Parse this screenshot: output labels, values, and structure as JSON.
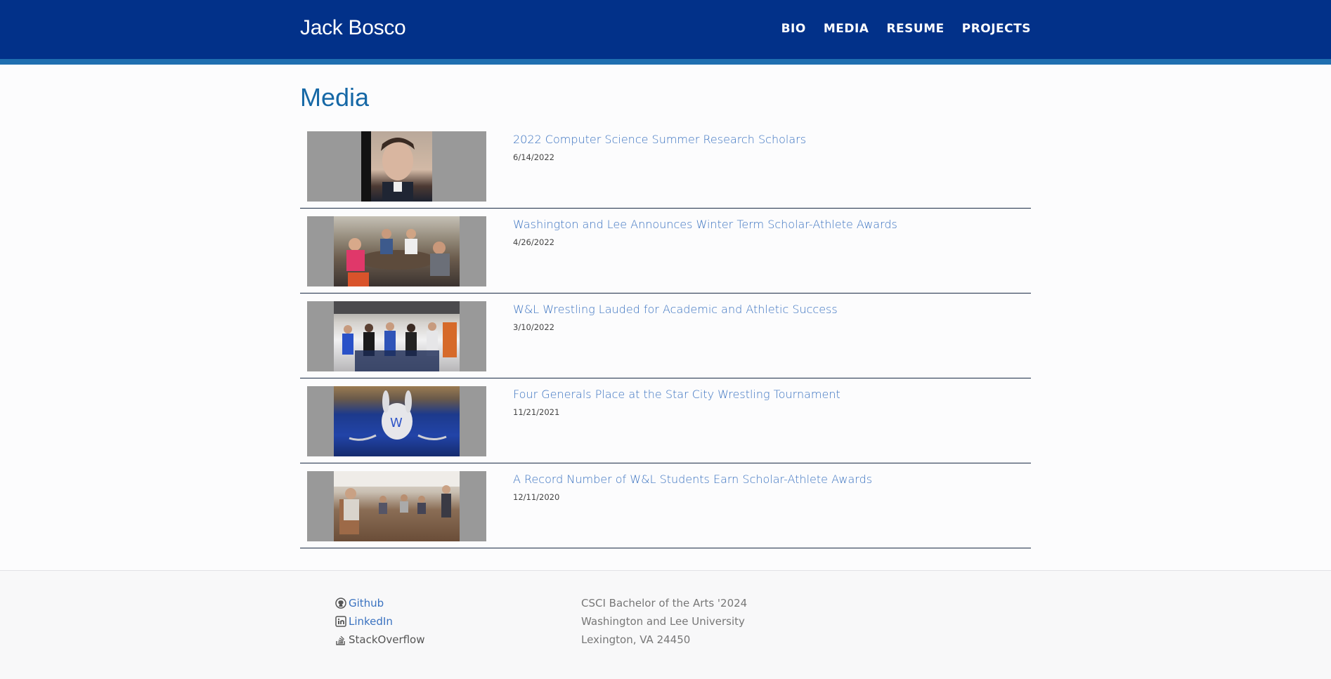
{
  "header": {
    "brand": "Jack Bosco",
    "nav": [
      "BIO",
      "MEDIA",
      "RESUME",
      "PROJECTS"
    ]
  },
  "page_title": "Media",
  "media": [
    {
      "title": "2022 Computer Science Summer Research Scholars",
      "date": "6/14/2022"
    },
    {
      "title": "Washington and Lee Announces Winter Term Scholar-Athlete Awards",
      "date": "4/26/2022"
    },
    {
      "title": "W&L Wrestling Lauded for Academic and Athletic Success",
      "date": "3/10/2022"
    },
    {
      "title": "Four Generals Place at the Star City Wrestling Tournament",
      "date": "11/21/2021"
    },
    {
      "title": "A Record Number of W&L Students Earn Scholar-Athlete Awards",
      "date": "12/11/2020"
    }
  ],
  "footer": {
    "links": [
      {
        "label": "Github",
        "icon": "github-icon"
      },
      {
        "label": "LinkedIn",
        "icon": "linkedin-icon"
      },
      {
        "label": "StackOverflow",
        "icon": "stackoverflow-icon"
      }
    ],
    "address": [
      "CSCI Bachelor of the Arts '2024",
      "Washington and Lee University",
      "Lexington, VA 24450"
    ]
  },
  "colors": {
    "header_bg": "#023189",
    "header_stripe": "#1f6fb0",
    "title": "#1668a6",
    "link": "#3a72c0"
  }
}
